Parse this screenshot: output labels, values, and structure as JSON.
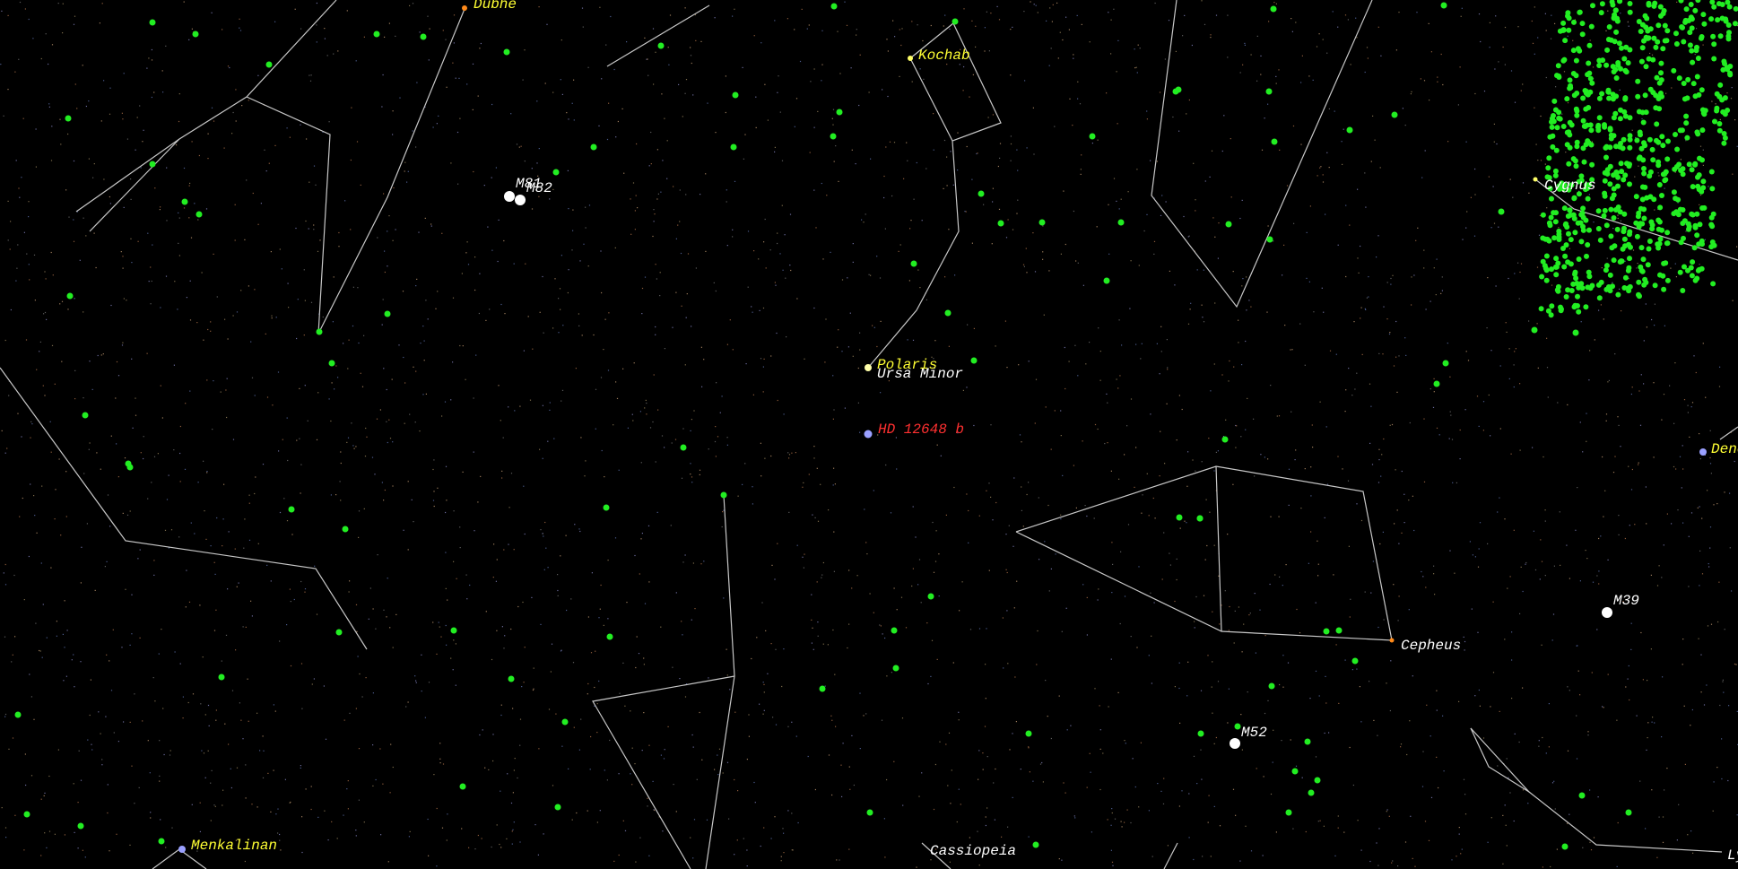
{
  "colors": {
    "background": "#000000",
    "constellation_line": "#c8c8c8",
    "star_label": "#ffff33",
    "object_label": "#ffffff",
    "planet_label": "#ff3030",
    "green_marker": "#22ee22",
    "galaxy_marker": "#ffffff"
  },
  "labels": {
    "dubhe": "Dubhe",
    "kochab": "Kochab",
    "polaris": "Polaris",
    "ursa_minor": "Ursa Minor",
    "hd12648b": "HD 12648 b",
    "m81": "M81",
    "m82": "M82",
    "cepheus": "Cepheus",
    "m39": "M39",
    "m52": "M52",
    "menkalinan": "Menkalinan",
    "cassiopeia": "Cassiopeia",
    "deneb": "Deneb",
    "cygnus": "Cygnus",
    "lyra": "Lyra"
  },
  "icons": {
    "galaxy": "galaxy-marker-icon",
    "cluster": "cluster-marker-icon",
    "exoplanet": "exoplanet-marker-icon",
    "star": "bright-star-icon"
  }
}
